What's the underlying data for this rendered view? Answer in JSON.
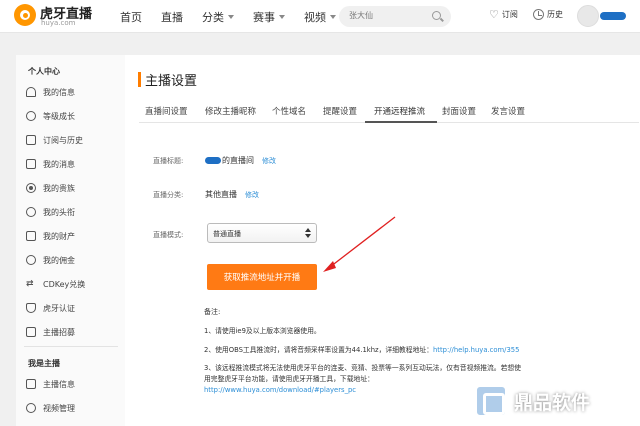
{
  "brand": {
    "name": "虎牙直播",
    "url": "huya.com",
    "accent": "#ff7a14",
    "link_color": "#2c8ed6"
  },
  "nav": {
    "items": [
      {
        "label": "首页"
      },
      {
        "label": "直播"
      },
      {
        "label": "分类"
      },
      {
        "label": "赛事"
      },
      {
        "label": "视频"
      }
    ],
    "search_value": "张大仙",
    "subscribe_label": "订阅",
    "history_label": "历史"
  },
  "sidebar": {
    "group1_title": "个人中心",
    "group1_items": [
      {
        "label": "我的信息",
        "icon": "home-icon"
      },
      {
        "label": "等级成长",
        "icon": "medal-icon"
      },
      {
        "label": "订阅与历史",
        "icon": "subscribe-icon"
      },
      {
        "label": "我的消息",
        "icon": "message-icon"
      },
      {
        "label": "我的贵族",
        "icon": "noble-icon"
      },
      {
        "label": "我的头衔",
        "icon": "badge-icon"
      },
      {
        "label": "我的财产",
        "icon": "wallet-icon"
      },
      {
        "label": "我的佣金",
        "icon": "commission-icon"
      },
      {
        "label": "CDKey兑换",
        "icon": "cdkey-icon"
      },
      {
        "label": "虎牙认证",
        "icon": "verify-icon"
      },
      {
        "label": "主播招募",
        "icon": "recruit-icon"
      }
    ],
    "group2_title": "我是主播",
    "group2_items": [
      {
        "label": "主播信息",
        "icon": "info-icon"
      },
      {
        "label": "视频管理",
        "icon": "video-icon"
      }
    ]
  },
  "main": {
    "title": "主播设置",
    "tabs": [
      {
        "label": "直播间设置"
      },
      {
        "label": "修改主播昵称"
      },
      {
        "label": "个性域名"
      },
      {
        "label": "提醒设置"
      },
      {
        "label": "开通远程推流"
      },
      {
        "label": "封面设置"
      },
      {
        "label": "发言设置"
      }
    ],
    "active_tab": "开通远程推流",
    "fields": {
      "title_label": "直播标题:",
      "title_value": "的直播间",
      "title_edit": "修改",
      "category_label": "直播分类:",
      "category_value": "其他直播",
      "category_edit": "修改",
      "mode_label": "直播模式:",
      "mode_value": "普通直播"
    },
    "cta_label": "获取推流地址并开播",
    "notes": {
      "title": "备注:",
      "line1": "1、请使用ie9及以上版本浏览器使用。",
      "line2_text": "2、使用OBS工具推流时，请将音频采样率设置为44.1khz，详细教程地址：",
      "line2_link": "http://help.huya.com/355",
      "line3a": "3、该远程推流模式将无法使用虎牙平台的连麦、竞猜、投票等一系列互动玩法，仅有音视频推流。若想使",
      "line3b": "用完整虎牙平台功能，请使用虎牙开播工具，下载地址：",
      "line3_link": "http://www.huya.com/download/#players_pc"
    }
  },
  "watermark": {
    "text": "鼎品软件"
  }
}
